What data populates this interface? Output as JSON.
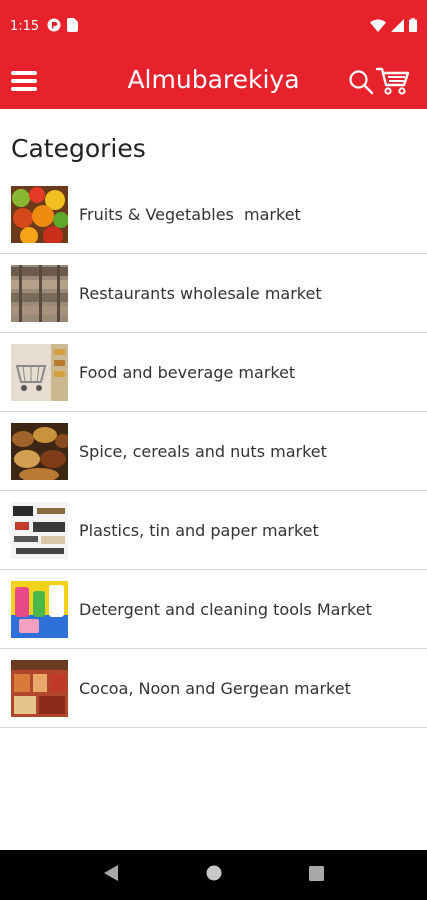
{
  "status_bar": {
    "time": "1:15",
    "icons": [
      "app-notification-icon",
      "sim-card-icon",
      "wifi-icon",
      "signal-icon",
      "battery-icon"
    ]
  },
  "app_bar": {
    "title": "Almubarekiya",
    "color": "#e8222d",
    "icons": [
      "menu-icon",
      "search-icon",
      "cart-icon"
    ]
  },
  "main": {
    "section_title": "Categories",
    "categories": [
      {
        "label": "Fruits & Vegetables  market",
        "thumb": "fruits-thumbnail"
      },
      {
        "label": "Restaurants wholesale market",
        "thumb": "restaurants-thumbnail"
      },
      {
        "label": "Food and beverage market",
        "thumb": "food-beverage-thumbnail"
      },
      {
        "label": "Spice, cereals and nuts market",
        "thumb": "spice-thumbnail"
      },
      {
        "label": "Plastics, tin and paper market",
        "thumb": "plastics-thumbnail"
      },
      {
        "label": "Detergent and cleaning tools Market",
        "thumb": "detergent-thumbnail"
      },
      {
        "label": "Cocoa, Noon and Gergean market",
        "thumb": "cocoa-thumbnail"
      }
    ]
  },
  "nav_bar": {
    "icons": [
      "back-icon",
      "home-icon",
      "recents-icon"
    ]
  }
}
